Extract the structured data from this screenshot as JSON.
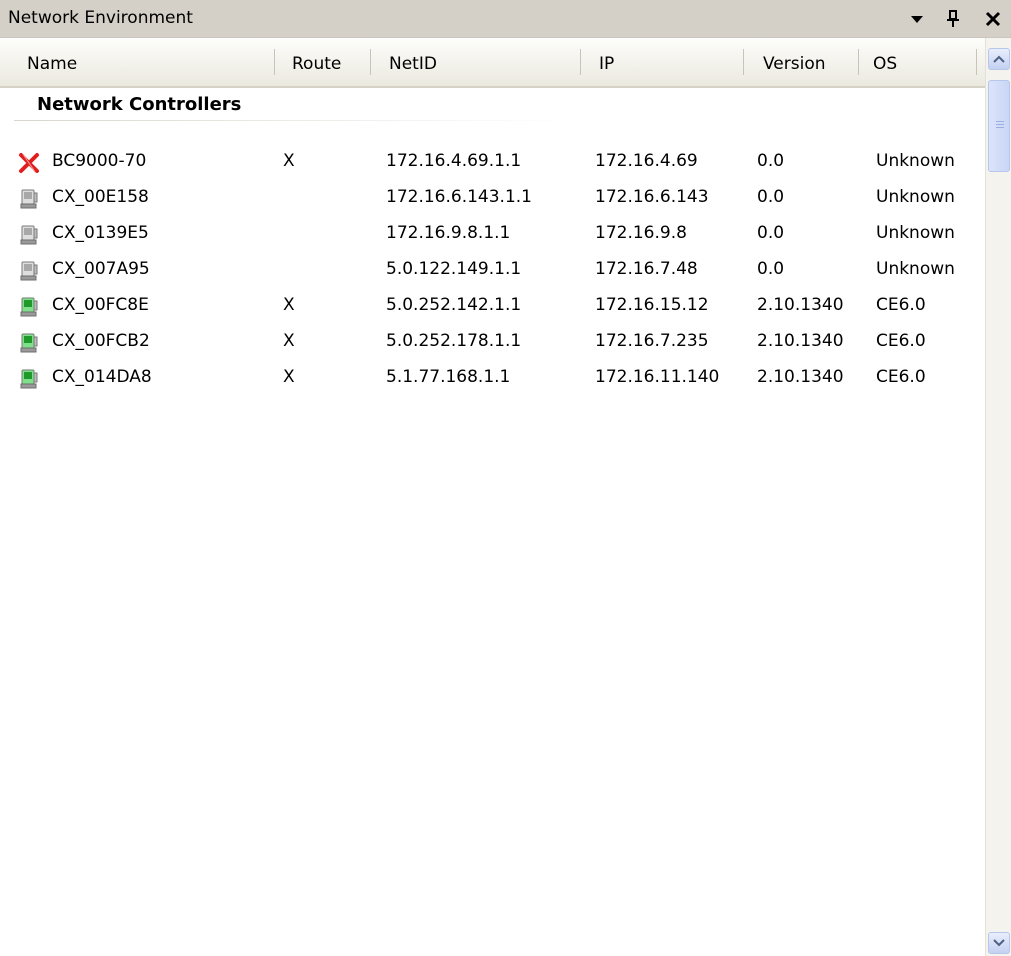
{
  "window": {
    "title": "Network Environment"
  },
  "columns": [
    "Name",
    "Route",
    "NetID",
    "IP",
    "Version",
    "OS"
  ],
  "group": {
    "label": "Network Controllers"
  },
  "rows": [
    {
      "status": "error",
      "name": "BC9000-70",
      "route": "X",
      "netid": "172.16.4.69.1.1",
      "ip": "172.16.4.69",
      "version": "0.0",
      "os": "Unknown"
    },
    {
      "status": "offline",
      "name": "CX_00E158",
      "route": "",
      "netid": "172.16.6.143.1.1",
      "ip": "172.16.6.143",
      "version": "0.0",
      "os": "Unknown"
    },
    {
      "status": "offline",
      "name": "CX_0139E5",
      "route": "",
      "netid": "172.16.9.8.1.1",
      "ip": "172.16.9.8",
      "version": "0.0",
      "os": "Unknown"
    },
    {
      "status": "offline",
      "name": "CX_007A95",
      "route": "",
      "netid": "5.0.122.149.1.1",
      "ip": "172.16.7.48",
      "version": "0.0",
      "os": "Unknown"
    },
    {
      "status": "online",
      "name": "CX_00FC8E",
      "route": "X",
      "netid": "5.0.252.142.1.1",
      "ip": "172.16.15.12",
      "version": "2.10.1340",
      "os": "CE6.0"
    },
    {
      "status": "online",
      "name": "CX_00FCB2",
      "route": "X",
      "netid": "5.0.252.178.1.1",
      "ip": "172.16.7.235",
      "version": "2.10.1340",
      "os": "CE6.0"
    },
    {
      "status": "online",
      "name": "CX_014DA8",
      "route": "X",
      "netid": "5.1.77.168.1.1",
      "ip": "172.16.11.140",
      "version": "2.10.1340",
      "os": "CE6.0"
    }
  ],
  "icons": {
    "dropdown": "chevron-down-icon",
    "pin": "pin-icon",
    "close": "close-icon",
    "error": "red-x-icon",
    "offline": "device-offline-icon",
    "online": "device-online-icon"
  },
  "colors": {
    "titlebar": "#d4d0c8",
    "online": "#1f9a2a",
    "offline": "#a8a8a8",
    "error": "#e02020"
  }
}
